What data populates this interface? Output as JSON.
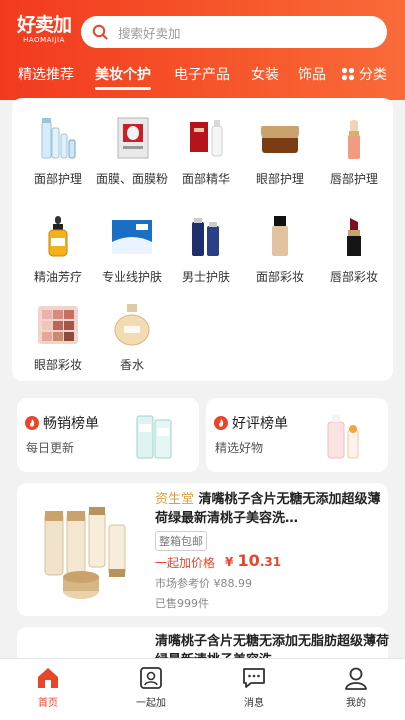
{
  "app": {
    "logo_text": "好卖加",
    "logo_sub": "HAOMAIJIA"
  },
  "search": {
    "placeholder": "搜索好卖加"
  },
  "tabs": [
    {
      "label": "精选推荐"
    },
    {
      "label": "美妆个护"
    },
    {
      "label": "电子产品"
    },
    {
      "label": "女装"
    },
    {
      "label": "饰品"
    },
    {
      "label": "分类"
    }
  ],
  "active_tab": "美妆个护",
  "categories": [
    {
      "label": "面部护理",
      "icon": "toner-bottles-icon"
    },
    {
      "label": "面膜、面膜粉",
      "icon": "face-mask-box-icon"
    },
    {
      "label": "面部精华",
      "icon": "serum-bottle-icon"
    },
    {
      "label": "眼部护理",
      "icon": "eye-cream-jar-icon"
    },
    {
      "label": "唇部护理",
      "icon": "lip-balm-icon"
    },
    {
      "label": "精油芳疗",
      "icon": "essential-oil-dropper-icon"
    },
    {
      "label": "专业线护肤",
      "icon": "professional-skincare-box-icon"
    },
    {
      "label": "男士护肤",
      "icon": "mens-skincare-bottles-icon"
    },
    {
      "label": "面部彩妆",
      "icon": "foundation-bottle-icon"
    },
    {
      "label": "唇部彩妆",
      "icon": "lipstick-icon"
    },
    {
      "label": "眼部彩妆",
      "icon": "eyeshadow-palette-icon"
    },
    {
      "label": "香水",
      "icon": "perfume-bottle-icon"
    }
  ],
  "rankings": [
    {
      "title": "畅销榜单",
      "subtitle": "每日更新",
      "icon": "flame-icon"
    },
    {
      "title": "好评榜单",
      "subtitle": "精选好物",
      "icon": "flame-icon"
    }
  ],
  "products": [
    {
      "brand": "资生堂",
      "title": "清嘴桃子含片无糖无添加超级薄荷绿最新清桃子美容洗…",
      "badge": "整箱包邮",
      "price_label": "一起加价格",
      "price_symbol": "¥",
      "price_int": "10",
      "price_dec": ".31",
      "market_price": "市场参考价 ¥88.99",
      "sold": "已售999件"
    },
    {
      "brand": "",
      "title": "清嘴桃子含片无糖无添加无脂肪超级薄荷绿最新清桃子美容洗"
    }
  ],
  "bottom_nav": [
    {
      "label": "首页",
      "icon": "home-icon"
    },
    {
      "label": "一起加",
      "icon": "contact-card-icon"
    },
    {
      "label": "消息",
      "icon": "message-icon"
    },
    {
      "label": "我的",
      "icon": "user-icon"
    }
  ],
  "colors": {
    "brand": "#f23a1f",
    "price": "#e8462a",
    "brand_name": "#d7a046"
  }
}
